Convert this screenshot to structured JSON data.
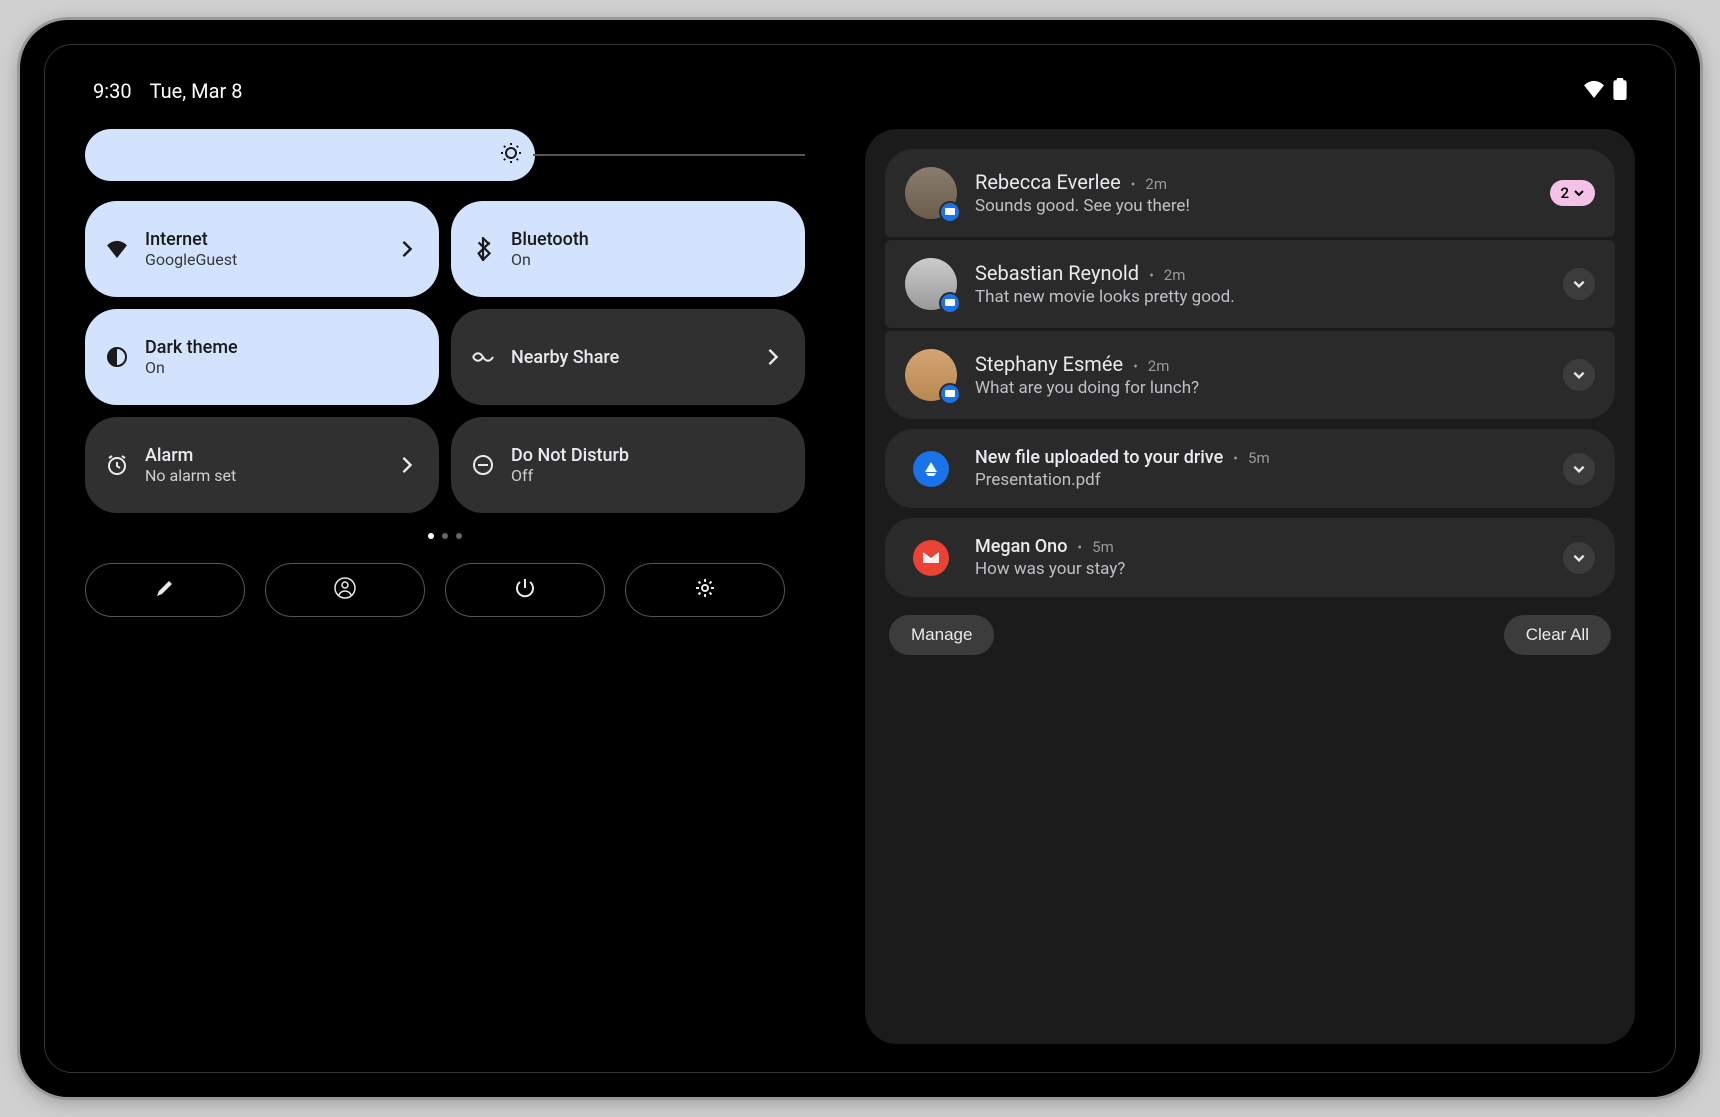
{
  "status": {
    "time": "9:30",
    "date": "Tue, Mar 8"
  },
  "tiles": {
    "internet": {
      "title": "Internet",
      "sub": "GoogleGuest"
    },
    "bluetooth": {
      "title": "Bluetooth",
      "sub": "On"
    },
    "dark_theme": {
      "title": "Dark theme",
      "sub": "On"
    },
    "nearby_share": {
      "title": "Nearby Share"
    },
    "alarm": {
      "title": "Alarm",
      "sub": "No alarm set"
    },
    "dnd": {
      "title": "Do Not Disturb",
      "sub": "Off"
    }
  },
  "notifications": [
    {
      "sender": "Rebecca Everlee",
      "time": "2m",
      "body": "Sounds good. See you there!",
      "count": "2"
    },
    {
      "sender": "Sebastian Reynold",
      "time": "2m",
      "body": "That new movie looks pretty good."
    },
    {
      "sender": "Stephany Esmée",
      "time": "2m",
      "body": "What are you doing for lunch?"
    },
    {
      "sender": "New file uploaded to your drive",
      "time": "5m",
      "body": "Presentation.pdf"
    },
    {
      "sender": "Megan Ono",
      "time": "5m",
      "body": "How was your stay?"
    }
  ],
  "footer": {
    "manage": "Manage",
    "clear_all": "Clear All"
  }
}
